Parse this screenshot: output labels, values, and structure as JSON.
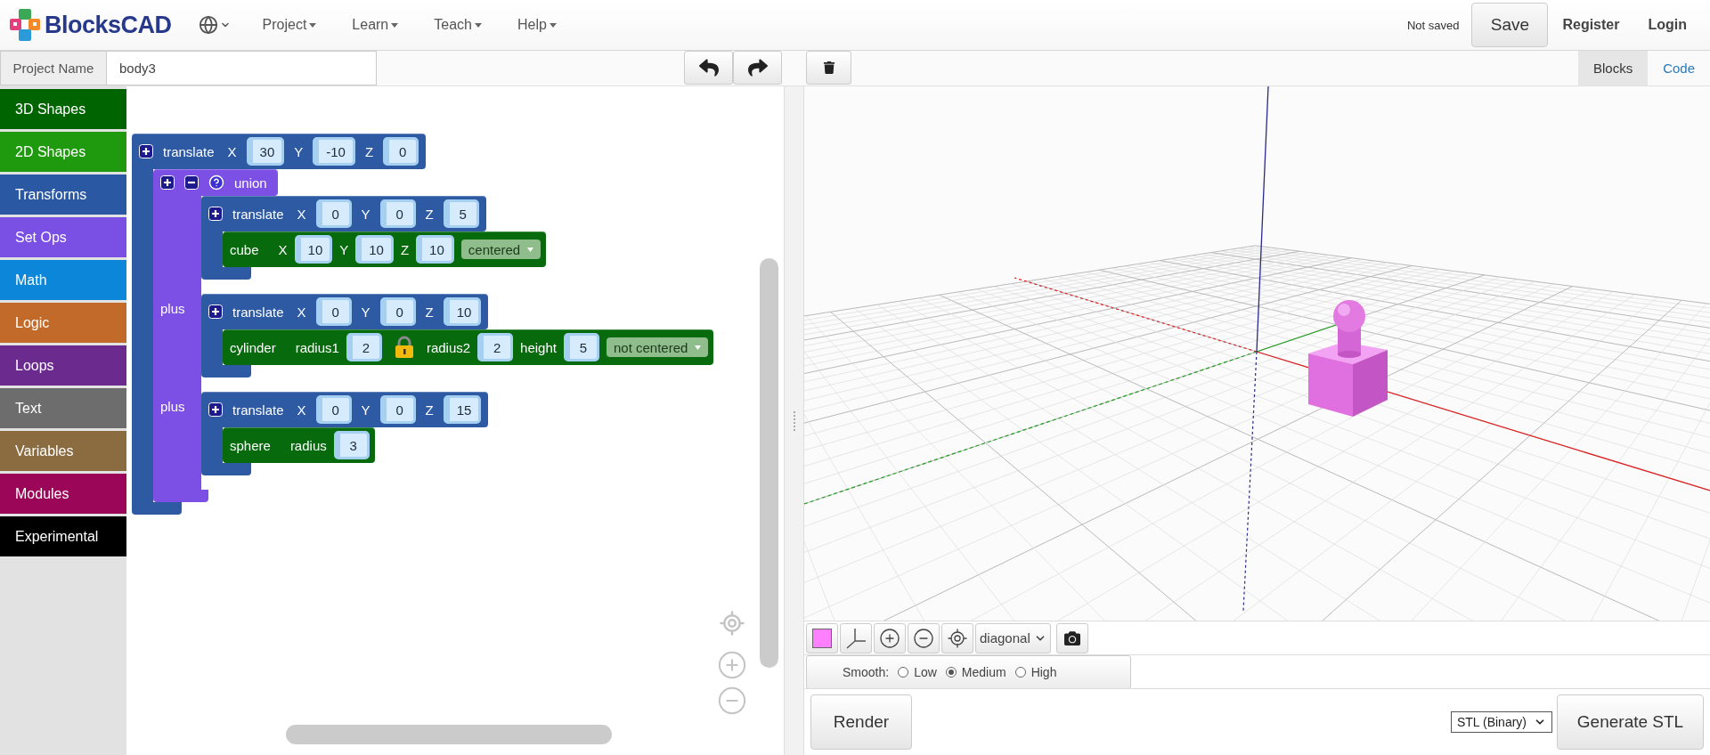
{
  "header": {
    "brand": "BlocksCAD",
    "nav": [
      {
        "label": "Project"
      },
      {
        "label": "Learn"
      },
      {
        "label": "Teach"
      },
      {
        "label": "Help"
      }
    ],
    "status": "Not saved",
    "save": "Save",
    "links": [
      "Register",
      "Login"
    ]
  },
  "project": {
    "label": "Project Name",
    "value": "body3"
  },
  "view_tabs": [
    {
      "label": "Blocks",
      "selected": true
    },
    {
      "label": "Code",
      "selected": false
    }
  ],
  "categories": [
    {
      "label": "3D Shapes",
      "color": "#006400"
    },
    {
      "label": "2D Shapes",
      "color": "#1f9a0e"
    },
    {
      "label": "Transforms",
      "color": "#2b58a2"
    },
    {
      "label": "Set Ops",
      "color": "#7a4fe3"
    },
    {
      "label": "Math",
      "color": "#0c86d8"
    },
    {
      "label": "Logic",
      "color": "#c26a29"
    },
    {
      "label": "Loops",
      "color": "#6a2a8e"
    },
    {
      "label": "Text",
      "color": "#6d6d6d"
    },
    {
      "label": "Variables",
      "color": "#8b6c40"
    },
    {
      "label": "Modules",
      "color": "#9c0658"
    },
    {
      "label": "Experimental",
      "color": "#000000"
    }
  ],
  "workspace": {
    "blocks": [
      {
        "kind": "transform",
        "label": "translate",
        "fields": [
          {
            "kind": "number",
            "label": "X",
            "value": "30"
          },
          {
            "kind": "number",
            "label": "Y",
            "value": "-10"
          },
          {
            "kind": "number",
            "label": "Z",
            "value": "0"
          }
        ],
        "children": [
          {
            "kind": "setop",
            "label": "union",
            "slots": [
              {
                "blocks": [
                  {
                    "kind": "transform",
                    "label": "translate",
                    "fields": [
                      {
                        "kind": "number",
                        "label": "X",
                        "value": "0"
                      },
                      {
                        "kind": "number",
                        "label": "Y",
                        "value": "0"
                      },
                      {
                        "kind": "number",
                        "label": "Z",
                        "value": "5"
                      }
                    ],
                    "children": [
                      {
                        "kind": "shape",
                        "label": "cube",
                        "fields": [
                          {
                            "kind": "number",
                            "label": "X",
                            "value": "10"
                          },
                          {
                            "kind": "number",
                            "label": "Y",
                            "value": "10"
                          },
                          {
                            "kind": "number",
                            "label": "Z",
                            "value": "10"
                          },
                          {
                            "kind": "dropdown",
                            "value": "centered"
                          }
                        ]
                      }
                    ]
                  }
                ]
              },
              {
                "connector": "plus",
                "blocks": [
                  {
                    "kind": "transform",
                    "label": "translate",
                    "fields": [
                      {
                        "kind": "number",
                        "label": "X",
                        "value": "0"
                      },
                      {
                        "kind": "number",
                        "label": "Y",
                        "value": "0"
                      },
                      {
                        "kind": "number",
                        "label": "Z",
                        "value": "10"
                      }
                    ],
                    "children": [
                      {
                        "kind": "shape",
                        "label": "cylinder",
                        "fields": [
                          {
                            "kind": "number",
                            "label": "radius1",
                            "value": "2"
                          },
                          {
                            "kind": "lock"
                          },
                          {
                            "kind": "number",
                            "label": "radius2",
                            "value": "2"
                          },
                          {
                            "kind": "number",
                            "label": "height",
                            "value": "5"
                          },
                          {
                            "kind": "dropdown",
                            "value": "not centered"
                          }
                        ]
                      }
                    ]
                  }
                ]
              },
              {
                "connector": "plus",
                "blocks": [
                  {
                    "kind": "transform",
                    "label": "translate",
                    "fields": [
                      {
                        "kind": "number",
                        "label": "X",
                        "value": "0"
                      },
                      {
                        "kind": "number",
                        "label": "Y",
                        "value": "0"
                      },
                      {
                        "kind": "number",
                        "label": "Z",
                        "value": "15"
                      }
                    ],
                    "children": [
                      {
                        "kind": "shape",
                        "label": "sphere",
                        "fields": [
                          {
                            "kind": "number",
                            "label": "radius",
                            "value": "3"
                          }
                        ]
                      }
                    ]
                  }
                ]
              }
            ]
          }
        ]
      }
    ]
  },
  "viewer": {
    "camera": "diagonal",
    "smooth": {
      "label": "Smooth:",
      "options": [
        {
          "label": "Low",
          "selected": false
        },
        {
          "label": "Medium",
          "selected": true
        },
        {
          "label": "High",
          "selected": false
        }
      ]
    },
    "render": "Render",
    "format": "STL (Binary)",
    "generate": "Generate STL"
  }
}
